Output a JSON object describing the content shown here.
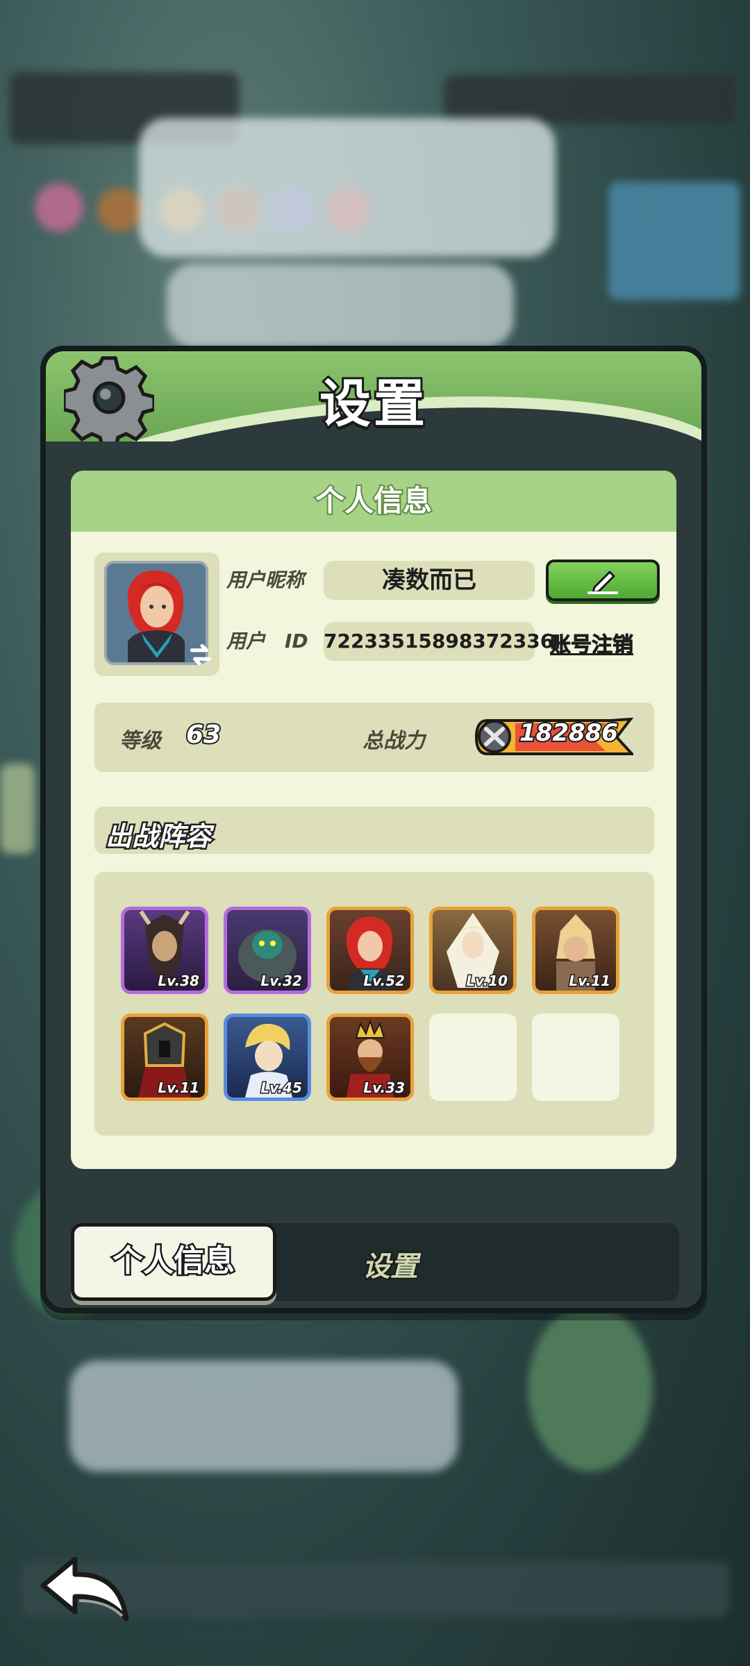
{
  "dialog": {
    "title": "设置",
    "icon": "gear-icon"
  },
  "profile": {
    "section_title": "个人信息",
    "nickname_label": "用户昵称",
    "nickname": "凑数而已",
    "id_label": "用户　ID",
    "user_id": "72233515898372336",
    "edit_icon": "pencil-icon",
    "cancel_account": "账号注销"
  },
  "stats": {
    "level_label": "等级",
    "level": "63",
    "power_label": "总战力",
    "power": "182886"
  },
  "lineup": {
    "title": "出战阵容",
    "heroes": [
      {
        "level": "Lv.38",
        "rarity": "epic"
      },
      {
        "level": "Lv.32",
        "rarity": "epic"
      },
      {
        "level": "Lv.52",
        "rarity": "legend"
      },
      {
        "level": "Lv.10",
        "rarity": "legend"
      },
      {
        "level": "Lv.11",
        "rarity": "legend"
      },
      {
        "level": "Lv.11",
        "rarity": "legend"
      },
      {
        "level": "Lv.45",
        "rarity": "rare"
      },
      {
        "level": "Lv.33",
        "rarity": "legend"
      },
      {
        "level": "",
        "rarity": "empty"
      },
      {
        "level": "",
        "rarity": "empty"
      }
    ]
  },
  "tabs": {
    "active": "个人信息",
    "inactive": "设置"
  },
  "colors": {
    "header_green": "#8cc46e",
    "panel_bg": "#f1f6dc",
    "epic_border": "#b56be0",
    "legend_border": "#e8a23a",
    "rare_border": "#5a8be0"
  }
}
